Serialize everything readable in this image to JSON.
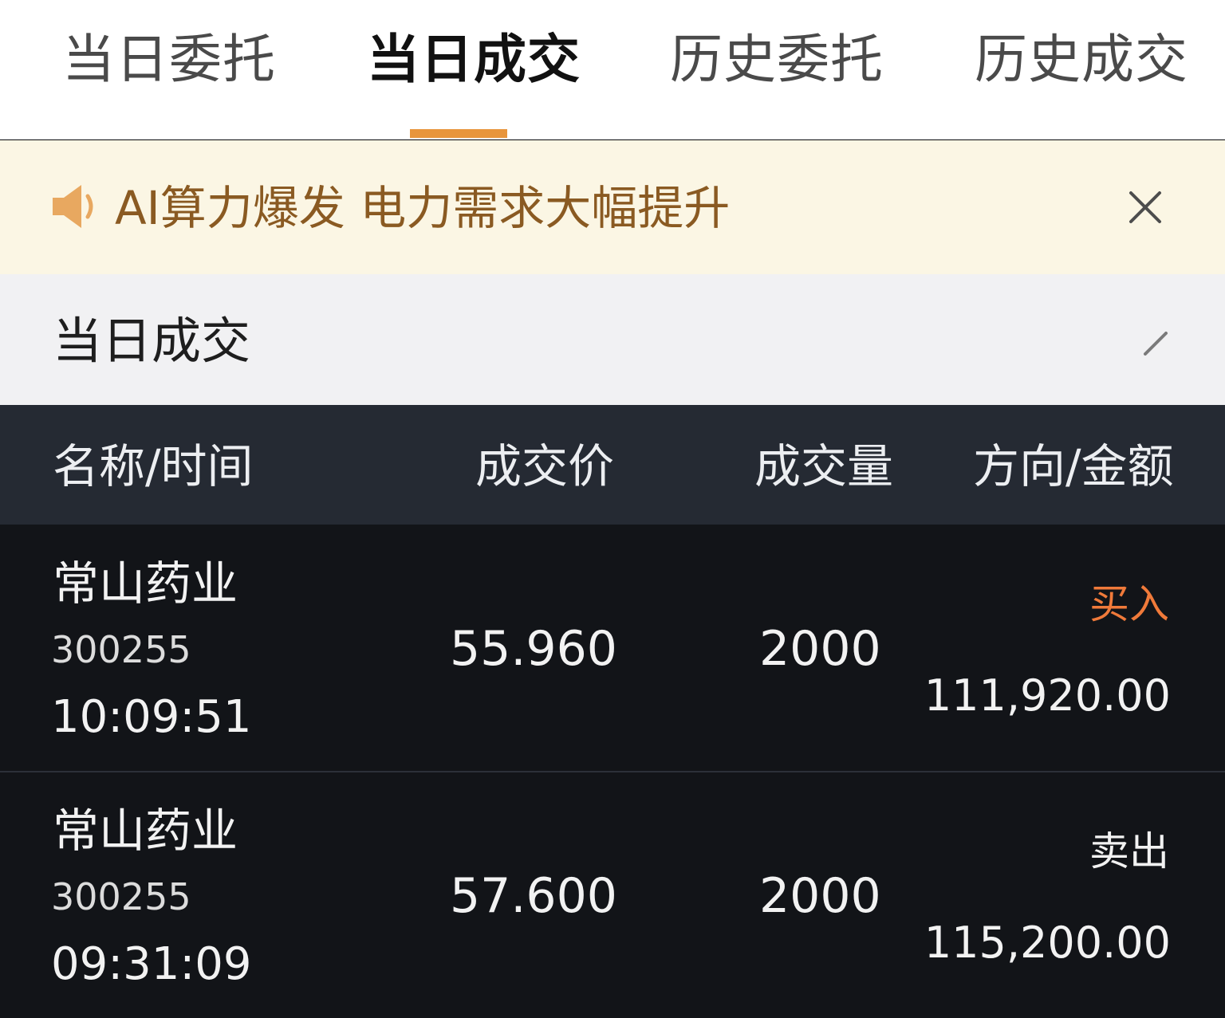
{
  "tabs": [
    {
      "label": "当日委托",
      "active": false
    },
    {
      "label": "当日成交",
      "active": true
    },
    {
      "label": "历史委托",
      "active": false
    },
    {
      "label": "历史成交",
      "active": false
    }
  ],
  "notice": {
    "icon": "speaker-icon",
    "text": "AI算力爆发 电力需求大幅提升",
    "close_icon": "close-icon"
  },
  "section": {
    "title": "当日成交",
    "action_icon": "edit-icon"
  },
  "table": {
    "headers": [
      "名称/时间",
      "成交价",
      "成交量",
      "方向/金额"
    ],
    "rows": [
      {
        "name": "常山药业",
        "code": "300255",
        "time": "10:09:51",
        "price": "55.960",
        "quantity": "2000",
        "direction": "买入",
        "amount": "111,920.00"
      },
      {
        "name": "常山药业",
        "code": "300255",
        "time": "09:31:09",
        "price": "57.600",
        "quantity": "2000",
        "direction": "卖出",
        "amount": "115,200.00"
      }
    ]
  },
  "colors": {
    "accent": "#e8953c",
    "buy": "#f07a3a",
    "sell": "#f2f2f2",
    "notice_text": "#8a5a22"
  }
}
